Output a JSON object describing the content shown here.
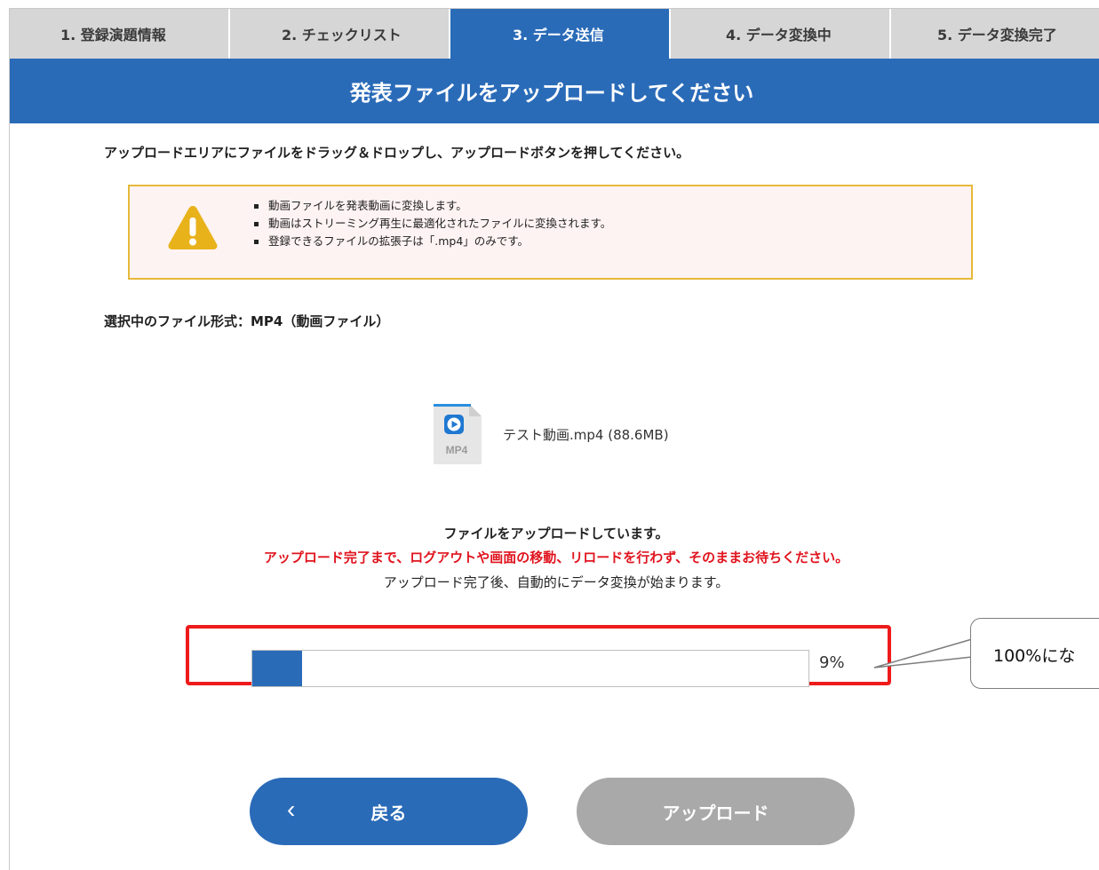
{
  "steps": [
    {
      "label": "1. 登録演題情報",
      "active": false
    },
    {
      "label": "2. チェックリスト",
      "active": false
    },
    {
      "label": "3. データ送信",
      "active": true
    },
    {
      "label": "4. データ変換中",
      "active": false
    },
    {
      "label": "5. データ変換完了",
      "active": false
    }
  ],
  "title": "発表ファイルをアップロードしてください",
  "instruction": "アップロードエリアにファイルをドラッグ＆ドロップし、アップロードボタンを押してください。",
  "notice": {
    "icon": "warning-icon",
    "items": [
      "動画ファイルを発表動画に変換します。",
      "動画はストリーミング再生に最適化されたファイルに変換されます。",
      "登録できるファイルの拡張子は「.mp4」のみです。"
    ]
  },
  "file_type": "選択中のファイル形式：MP4（動画ファイル）",
  "file": {
    "icon": "mp4-file-icon",
    "icon_label": "MP4",
    "name": "テスト動画.mp4 (88.6MB)"
  },
  "messages": {
    "uploading": "ファイルをアップロードしています。",
    "warning": "アップロード完了まで、ログアウトや画面の移動、リロードを行わず、そのままお待ちください。",
    "after": "アップロード完了後、自動的にデータ変換が始まります。"
  },
  "progress": {
    "value": 9,
    "label": "9%"
  },
  "callout": {
    "text": "100%にな"
  },
  "buttons": {
    "back": "戻る",
    "back_icon": "chevron-left-icon",
    "upload": "アップロード"
  },
  "colors": {
    "primary": "#2a6bb8",
    "tab_inactive": "#d6d6d6",
    "warning_border": "#e6b93a",
    "warning_bg": "#fdf3f2",
    "alert_text": "#e0141e",
    "highlight": "#ee1b1b",
    "disabled": "#a9a9a9"
  }
}
